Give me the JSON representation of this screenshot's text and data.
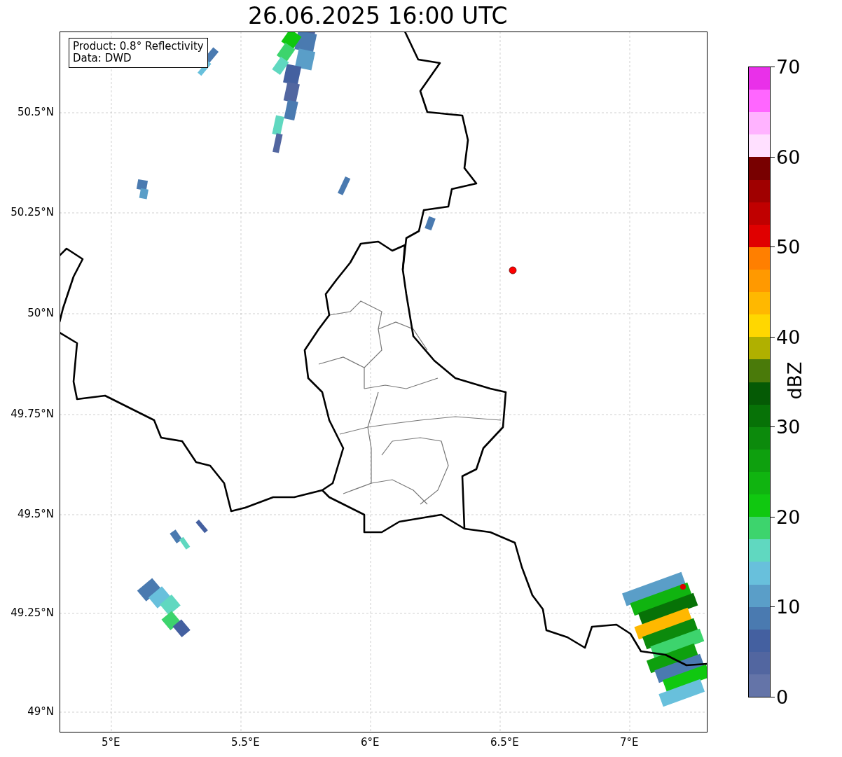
{
  "title": "26.06.2025 16:00 UTC",
  "annotation": [
    "Product: 0.8° Reflectivity",
    "Data: DWD"
  ],
  "map": {
    "x_ticks": [
      "5°E",
      "5.5°E",
      "6°E",
      "6.5°E",
      "7°E"
    ],
    "y_ticks": [
      "50.5°N",
      "50.25°N",
      "50°N",
      "49.75°N",
      "49.5°N",
      "49.25°N",
      "49°N"
    ]
  },
  "colorbar": {
    "label": "dBZ",
    "ticks": [
      "70",
      "60",
      "50",
      "40",
      "30",
      "20",
      "10",
      "0"
    ],
    "bins": [
      {
        "color": "#e930e9"
      },
      {
        "color": "#ff66ff"
      },
      {
        "color": "#ffb3ff"
      },
      {
        "color": "#ffe0ff"
      },
      {
        "color": "#780000"
      },
      {
        "color": "#a00000"
      },
      {
        "color": "#c00000"
      },
      {
        "color": "#e00000"
      },
      {
        "color": "#ff7f00"
      },
      {
        "color": "#ff9900"
      },
      {
        "color": "#ffb800"
      },
      {
        "color": "#ffd700"
      },
      {
        "color": "#b0b000"
      },
      {
        "color": "#4a7a0a"
      },
      {
        "color": "#055a05"
      },
      {
        "color": "#077207"
      },
      {
        "color": "#0c8a0c"
      },
      {
        "color": "#0ea00e"
      },
      {
        "color": "#10b410"
      },
      {
        "color": "#10c810"
      },
      {
        "color": "#3dd46d"
      },
      {
        "color": "#60d8c0"
      },
      {
        "color": "#68c0dc"
      },
      {
        "color": "#5a9ec8"
      },
      {
        "color": "#4a7ab0"
      },
      {
        "color": "#4460a0"
      },
      {
        "color": "#5266a0"
      },
      {
        "color": "#6474a8"
      }
    ]
  }
}
